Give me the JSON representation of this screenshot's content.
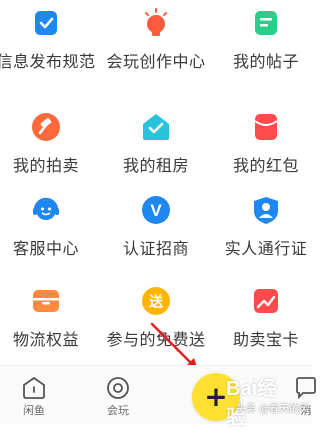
{
  "grid": {
    "items": [
      {
        "label": "信息发布规范",
        "icon": "document-check-icon",
        "color": "#1e88f0"
      },
      {
        "label": "会玩创作中心",
        "icon": "lightbulb-icon",
        "color": "#ff5a3c"
      },
      {
        "label": "我的帖子",
        "icon": "posts-icon",
        "color": "#2ecc8a"
      },
      {
        "label": "我的拍卖",
        "icon": "auction-hammer-icon",
        "color": "#ff6a3d"
      },
      {
        "label": "我的租房",
        "icon": "house-check-icon",
        "color": "#27c2dc"
      },
      {
        "label": "我的红包",
        "icon": "red-packet-icon",
        "color": "#ff4b4b"
      },
      {
        "label": "客服中心",
        "icon": "customer-service-icon",
        "color": "#1e88f0"
      },
      {
        "label": "认证招商",
        "icon": "verified-v-icon",
        "color": "#1e88f0"
      },
      {
        "label": "实人通行证",
        "icon": "person-pass-icon",
        "color": "#1e88f0"
      },
      {
        "label": "物流权益",
        "icon": "logistics-box-icon",
        "color": "#ff8a3d"
      },
      {
        "label": "参与的免费送",
        "icon": "free-gift-icon",
        "color": "#ffb400"
      },
      {
        "label": "助卖宝卡",
        "icon": "sales-chart-icon",
        "color": "#ff4b4b"
      }
    ]
  },
  "free_gift_char": "送",
  "verified_char": "V",
  "tabbar": {
    "tabs": [
      {
        "label": "闲鱼",
        "icon": "home-icon"
      },
      {
        "label": "会玩",
        "icon": "circle-icon"
      },
      {
        "label": "消",
        "icon": "message-icon"
      }
    ],
    "publish_icon": "plus-icon"
  },
  "watermark": {
    "logo": "Bai经验",
    "text": "头条 @春天的风"
  }
}
